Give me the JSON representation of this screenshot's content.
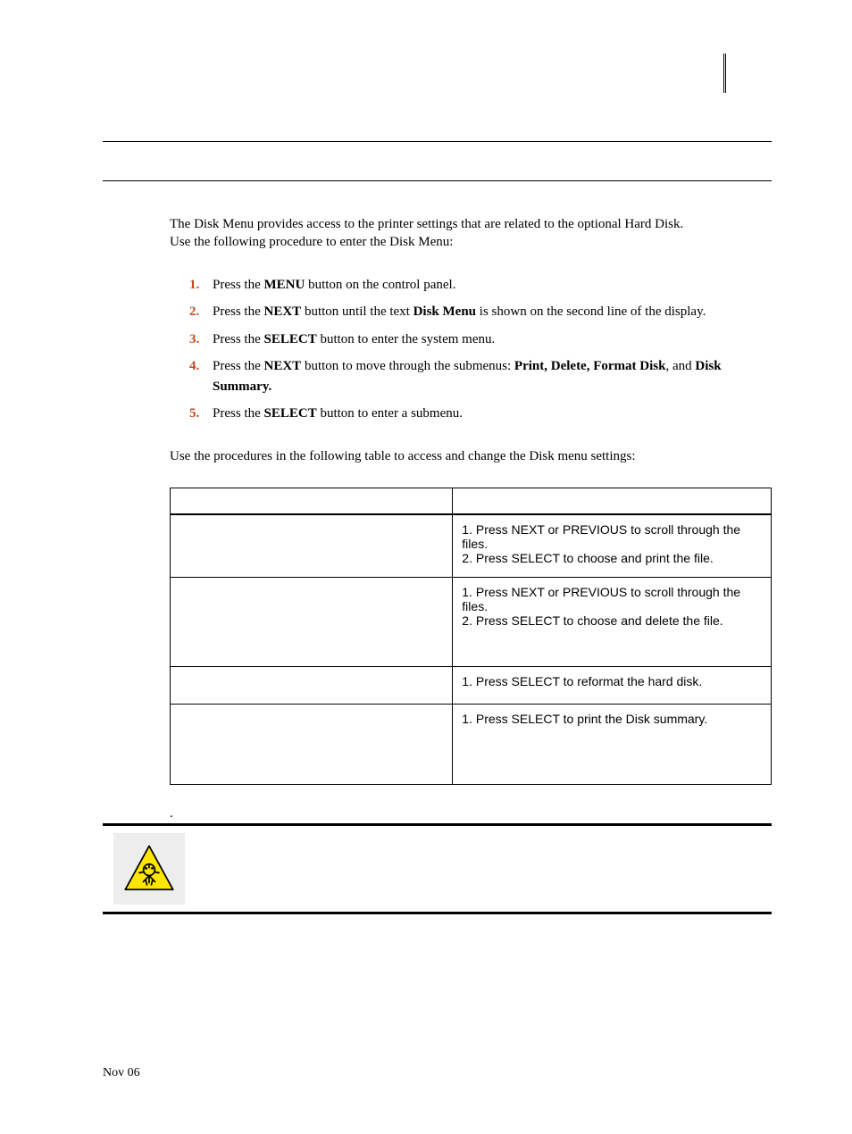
{
  "intro_line1": "The Disk Menu provides access to the printer settings that are related to the optional Hard Disk.",
  "intro_line2": "Use the following procedure to enter the Disk Menu:",
  "steps": {
    "s1": {
      "num": "1.",
      "pre": "Press the ",
      "bold": "MENU",
      "post": " button on the control panel."
    },
    "s2": {
      "num": "2.",
      "pre": "Press the ",
      "bold1": "NEXT",
      "mid": " button until the text ",
      "bold2": "Disk Menu",
      "post": " is shown on the second line of the display."
    },
    "s3": {
      "num": "3.",
      "pre": "Press the ",
      "bold": "SELECT",
      "post": " button to enter the system menu."
    },
    "s4": {
      "num": "4.",
      "pre": "Press the ",
      "bold1": "NEXT",
      "mid": " button to move through the submenus: ",
      "bold2": "Print, Delete, Format Disk",
      "post2_pre": ", and ",
      "bold3": "Disk Summary."
    },
    "s5": {
      "num": "5.",
      "pre": "Press the ",
      "bold": "SELECT",
      "post": " button to enter a submenu."
    }
  },
  "use_procedures": "Use the procedures in the following table to access and change the Disk menu settings:",
  "table": {
    "header": {
      "col1": "",
      "col2": ""
    },
    "rows": [
      {
        "left": "",
        "right_l1": "1. Press NEXT or PREVIOUS to scroll through the files.",
        "right_l2": "2. Press SELECT to choose and print the file."
      },
      {
        "left": "",
        "right_l1": "1. Press NEXT or PREVIOUS to scroll through the files.",
        "right_l2": "2. Press SELECT to choose and delete the file."
      },
      {
        "left": "",
        "right_l1": "1. Press SELECT to reformat the hard disk.",
        "right_l2": ""
      },
      {
        "left": "",
        "right_l1": "1. Press SELECT to print the Disk summary.",
        "right_l2": ""
      }
    ]
  },
  "dot": ".",
  "footer": "Nov 06"
}
